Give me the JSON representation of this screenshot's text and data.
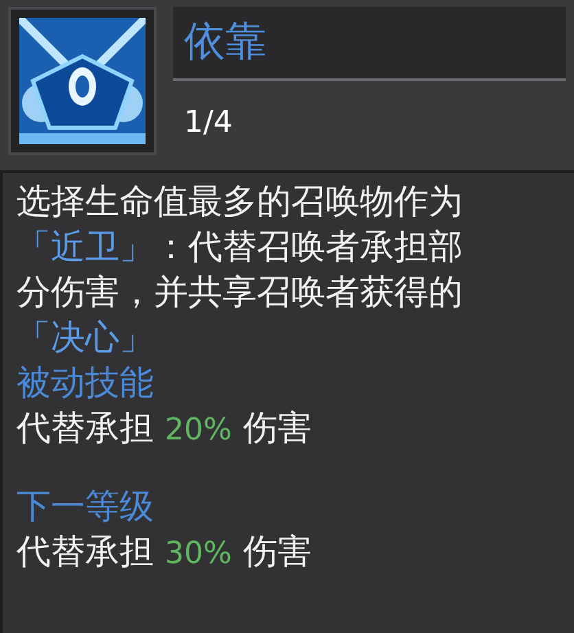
{
  "skill": {
    "name": "依靠",
    "level": "1/4"
  },
  "description_lines": [
    [
      {
        "kind": "plain",
        "text": "选择生命值最多的召唤物作为"
      }
    ],
    [
      {
        "kind": "keyword",
        "text": "「近卫」"
      },
      {
        "kind": "plain",
        "text": "：代替召唤者承担部"
      }
    ],
    [
      {
        "kind": "plain",
        "text": "分伤害，并共享召唤者获得的"
      }
    ],
    [
      {
        "kind": "keyword",
        "text": "「决心」"
      }
    ]
  ],
  "sections": [
    {
      "heading": "被动技能",
      "prefix": "代替承担",
      "value": "20%",
      "suffix": "伤害"
    },
    {
      "heading": "下一等级",
      "prefix": "代替承担",
      "value": "30%",
      "suffix": "伤害"
    }
  ]
}
